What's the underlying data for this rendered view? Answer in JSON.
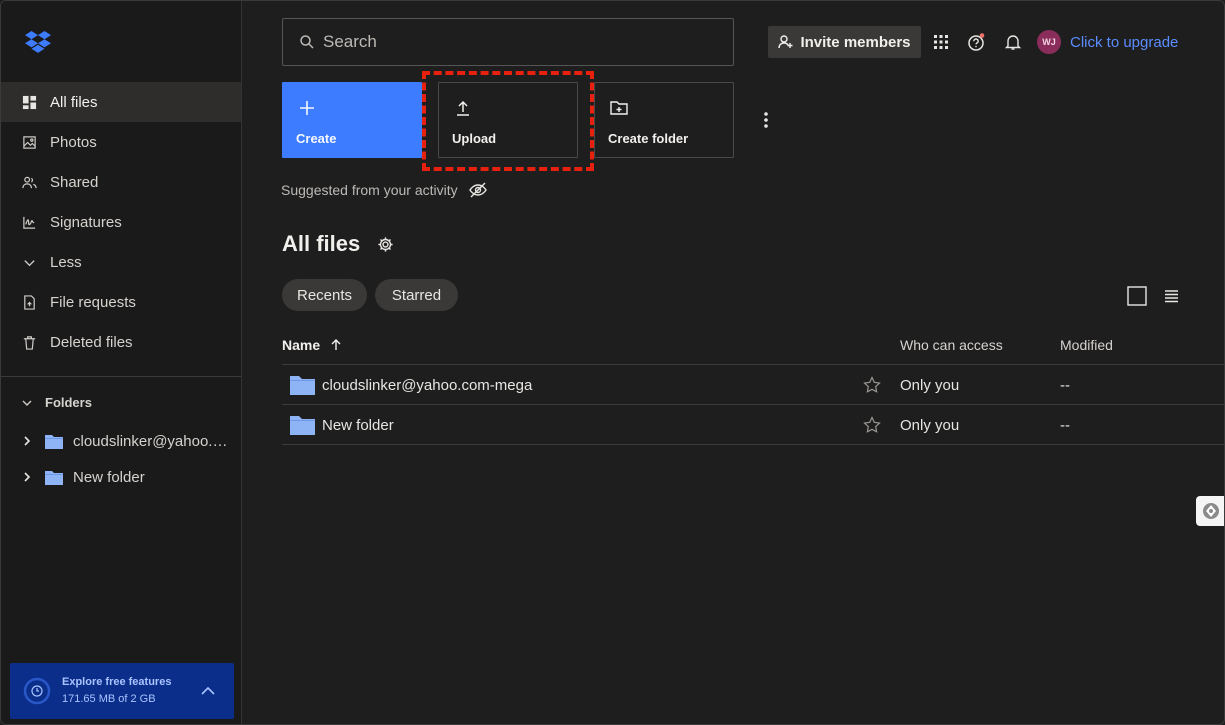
{
  "sidebar": {
    "items": [
      {
        "label": "All files",
        "icon": "all-files-icon"
      },
      {
        "label": "Photos",
        "icon": "photos-icon"
      },
      {
        "label": "Shared",
        "icon": "shared-icon"
      },
      {
        "label": "Signatures",
        "icon": "signatures-icon"
      },
      {
        "label": "Less",
        "icon": "chevron-down-icon"
      },
      {
        "label": "File requests",
        "icon": "file-requests-icon"
      },
      {
        "label": "Deleted files",
        "icon": "trash-icon"
      }
    ],
    "folders_label": "Folders",
    "tree": [
      {
        "label": "cloudslinker@yahoo.com-mega"
      },
      {
        "label": "New folder"
      }
    ],
    "promo": {
      "title": "Explore free features",
      "usage": "171.65 MB of 2 GB"
    }
  },
  "header": {
    "search_placeholder": "Search",
    "invite_label": "Invite members",
    "avatar_initials": "WJ",
    "upgrade_label": "Click to upgrade"
  },
  "actions": {
    "create": "Create",
    "upload": "Upload",
    "create_folder": "Create folder"
  },
  "suggested_label": "Suggested from your activity",
  "page_title": "All files",
  "filters": [
    "Recents",
    "Starred"
  ],
  "table": {
    "columns": {
      "name": "Name",
      "access": "Who can access",
      "modified": "Modified"
    },
    "rows": [
      {
        "name": "cloudslinker@yahoo.com-mega",
        "access": "Only you",
        "modified": "--"
      },
      {
        "name": "New folder",
        "access": "Only you",
        "modified": "--"
      }
    ]
  },
  "colors": {
    "accent": "#3d7bff",
    "highlight": "#e8200f",
    "folder": "#8fb4f5",
    "link": "#5b8dff"
  }
}
